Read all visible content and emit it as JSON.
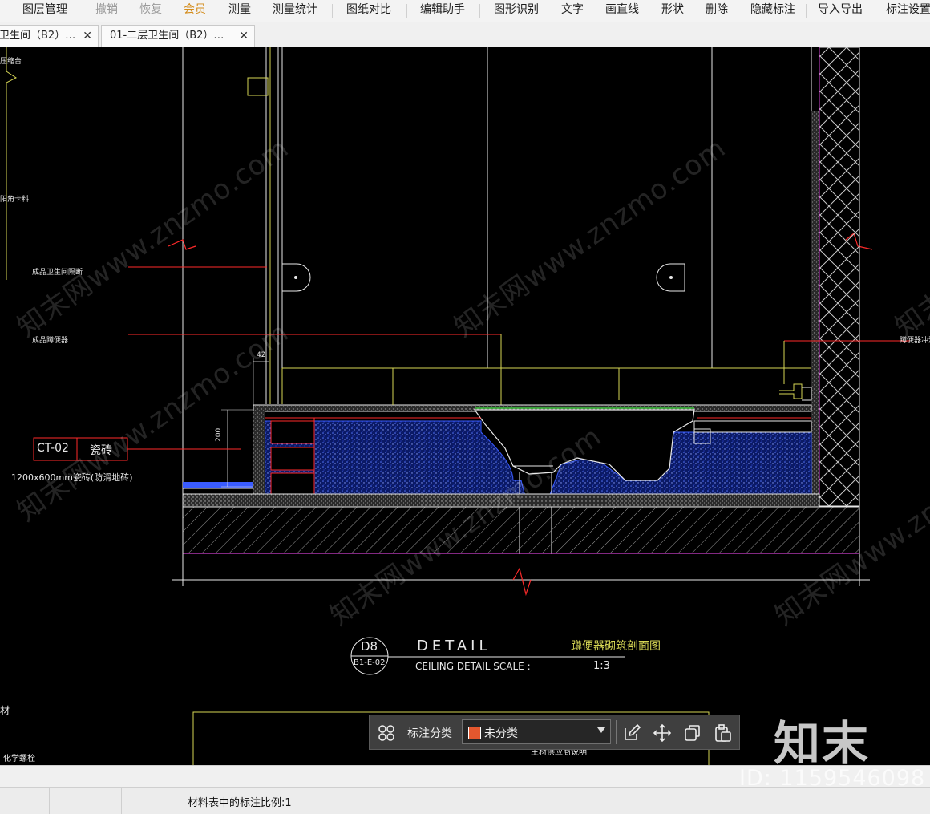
{
  "menu": {
    "items": [
      {
        "label": "图层管理",
        "state": "normal"
      },
      {
        "label": "撤销",
        "state": "disabled"
      },
      {
        "label": "恢复",
        "state": "disabled"
      },
      {
        "label": "会员",
        "state": "vip"
      },
      {
        "label": "测量",
        "state": "normal"
      },
      {
        "label": "测量统计",
        "state": "normal"
      },
      {
        "label": "图纸对比",
        "state": "normal"
      },
      {
        "label": "编辑助手",
        "state": "normal"
      },
      {
        "label": "图形识别",
        "state": "normal"
      },
      {
        "label": "文字",
        "state": "normal"
      },
      {
        "label": "画直线",
        "state": "normal"
      },
      {
        "label": "形状",
        "state": "normal"
      },
      {
        "label": "删除",
        "state": "normal"
      },
      {
        "label": "隐藏标注",
        "state": "normal"
      },
      {
        "label": "导入导出",
        "state": "normal"
      },
      {
        "label": "标注设置",
        "state": "normal"
      }
    ]
  },
  "tabs": [
    {
      "label": "卫生间（B2）…",
      "close": "✕"
    },
    {
      "label": "01-二层卫生间（B2）…",
      "close": "✕"
    }
  ],
  "drawing": {
    "left_labels": [
      "压缩台",
      "阳角卡料",
      "成品卫生间隔断",
      "成品蹲便器"
    ],
    "right_label": "蹲便器冲洗阀",
    "dim_42": "42",
    "dim_200": "200",
    "tag_code": "CT-02",
    "tag_material": "瓷砖",
    "tag_spec": "1200x600mm瓷砖(防滑地砖)",
    "detail_id": "D8",
    "detail_ref": "B1-E-02",
    "detail_word": "DETAIL",
    "detail_title": "蹲便器砌筑剖面图",
    "detail_sub": "CEILING DETAIL   SCALE :",
    "detail_scale": "1:3",
    "bottom_left_1": "材",
    "bottom_left_2": "化学螺栓",
    "bottom_note": "主材供应商说明"
  },
  "watermark": {
    "text": "知末网www.znzmo.com",
    "logo": "知末",
    "id": "ID: 1159546098"
  },
  "toolbar": {
    "label": "标注分类",
    "selected": "未分类",
    "swatch_color": "#e4572e"
  },
  "status": {
    "text": "材料表中的标注比例:1"
  },
  "colors": {
    "cad_yellow": "#d6d655",
    "cad_white": "#e8e8e8",
    "cad_red": "#ff2a2a",
    "cad_blue": "#3a5cff",
    "cad_magenta": "#d040d0",
    "cad_green": "#3fc53f"
  }
}
